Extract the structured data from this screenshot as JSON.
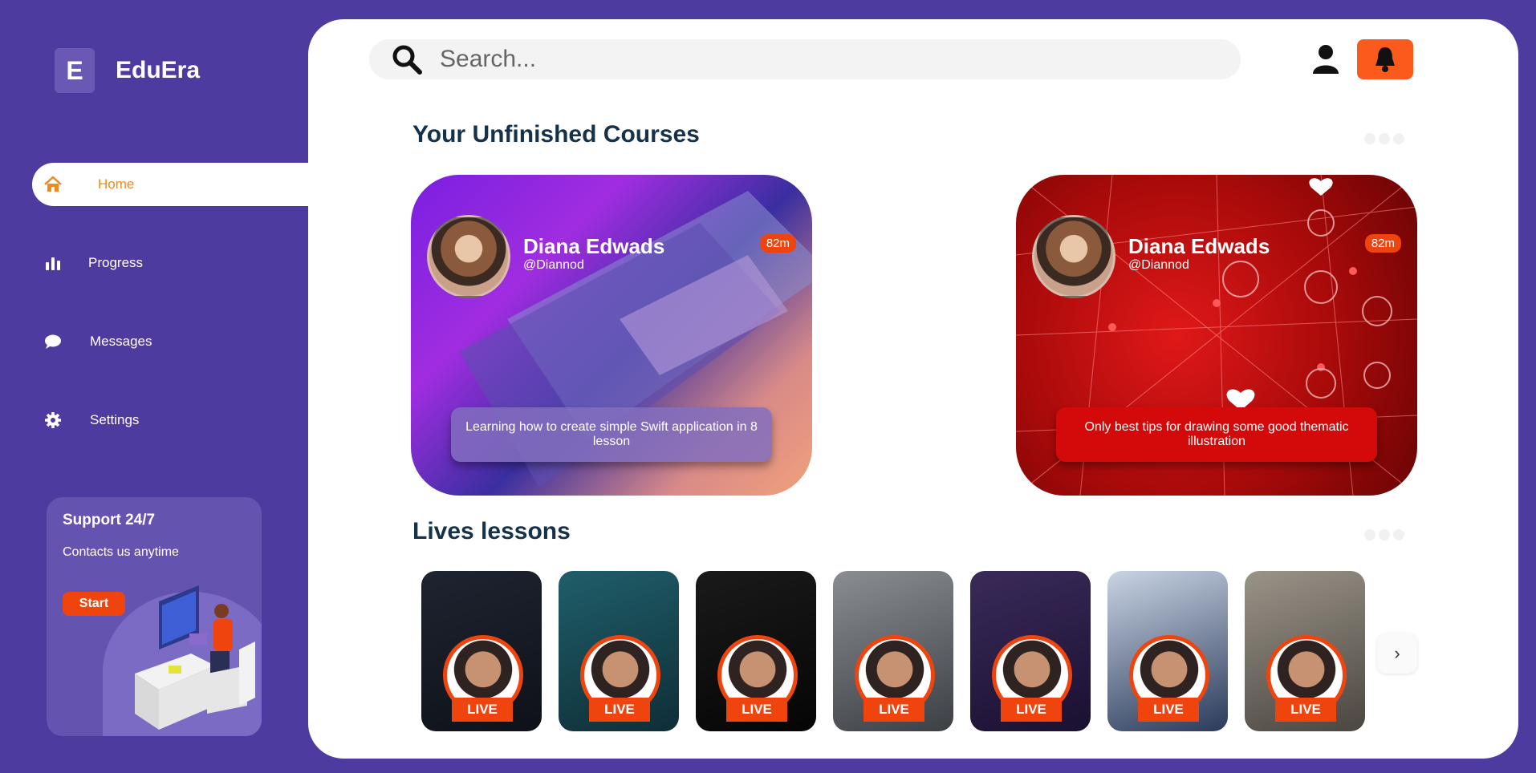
{
  "brand": {
    "initial": "E",
    "name": "EduEra"
  },
  "sidebar": {
    "items": [
      {
        "label": "Home",
        "icon": "home-icon",
        "active": true
      },
      {
        "label": "Progress",
        "icon": "bar-chart-icon",
        "active": false
      },
      {
        "label": "Messages",
        "icon": "chat-bubble-icon",
        "active": false
      },
      {
        "label": "Settings",
        "icon": "gear-icon",
        "active": false
      }
    ]
  },
  "support": {
    "title": "Support 24/7",
    "subtitle": "Contacts us anytime",
    "button": "Start"
  },
  "search": {
    "placeholder": "Search..."
  },
  "sections": {
    "unfinished": "Your Unfinished Courses",
    "lives": "Lives lessons"
  },
  "courses": [
    {
      "name": "Diana Edwads",
      "handle": "@Diannod",
      "duration": "82m",
      "description": "Learning how to create simple Swift application in 8 lesson"
    },
    {
      "name": "Diana Edwads",
      "handle": "@Diannod",
      "duration": "82m",
      "description": "Only best tips for drawing some good thematic illustration"
    }
  ],
  "lives": [
    {
      "label": "LIVE"
    },
    {
      "label": "LIVE"
    },
    {
      "label": "LIVE"
    },
    {
      "label": "LIVE"
    },
    {
      "label": "LIVE"
    },
    {
      "label": "LIVE"
    },
    {
      "label": "LIVE"
    }
  ],
  "colors": {
    "background": "#4e3ba0",
    "accent": "#f0440f",
    "active_nav_text": "#f08a1b",
    "heading": "#16324a"
  }
}
